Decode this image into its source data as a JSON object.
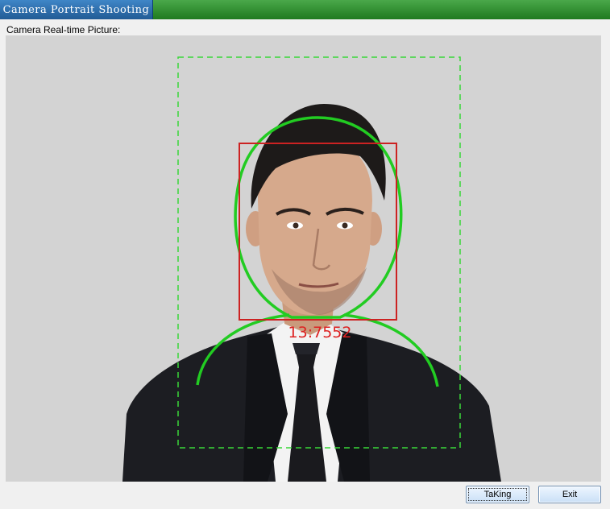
{
  "window": {
    "title": "Camera Portrait Shooting"
  },
  "preview": {
    "caption": "Camera Real-time Picture:",
    "score_text": "13:7552"
  },
  "buttons": {
    "taking_label": "TaKing",
    "exit_label": "Exit"
  },
  "colors": {
    "title_tab": "#2f6fae",
    "title_bar": "#2e8b2e",
    "guide_green": "#22cc22",
    "face_box": "#cc2222",
    "preview_bg": "#d3d3d3"
  }
}
